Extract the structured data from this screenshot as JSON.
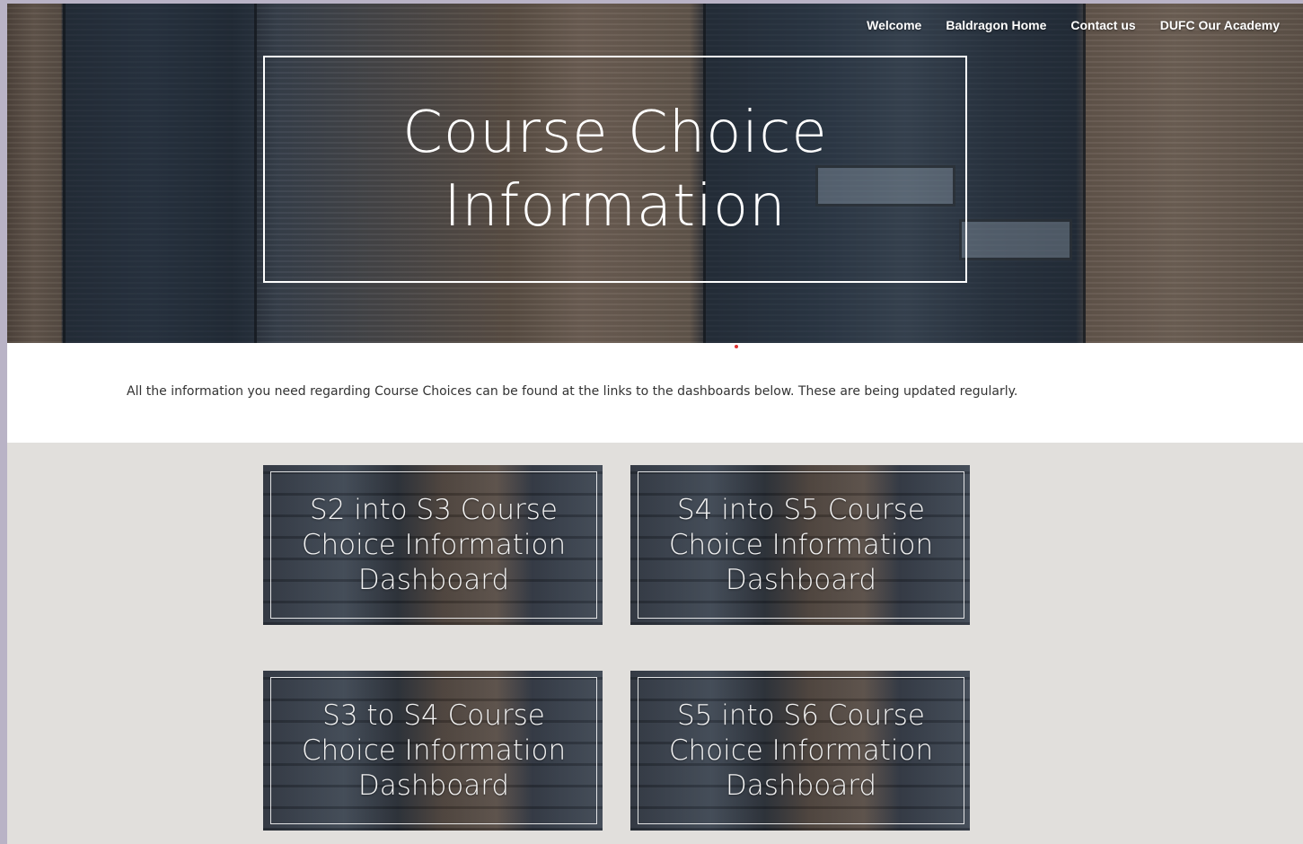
{
  "nav": {
    "items": [
      {
        "label": "Welcome"
      },
      {
        "label": "Baldragon Home"
      },
      {
        "label": "Contact us"
      },
      {
        "label": "DUFC Our Academy"
      }
    ]
  },
  "hero": {
    "title": "Course Choice Information"
  },
  "intro": {
    "text": "All the information you need regarding Course Choices can be found at the links to the dashboards below. These are being updated regularly."
  },
  "dashboards": [
    {
      "label": "S2 into S3 Course Choice Information Dashboard"
    },
    {
      "label": "S4 into S5 Course Choice Information Dashboard"
    },
    {
      "label": "S3 to S4 Course Choice Information Dashboard"
    },
    {
      "label": "S5 into S6 Course Choice Information Dashboard"
    }
  ]
}
